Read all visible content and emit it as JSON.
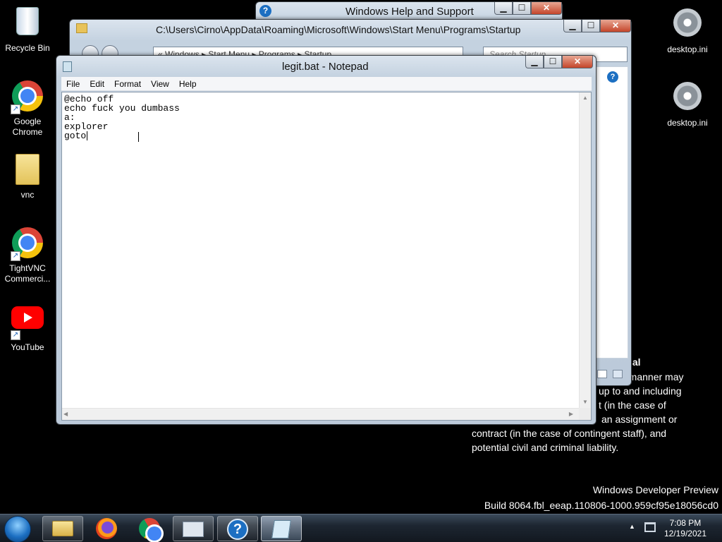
{
  "desktop": {
    "icons_left": [
      {
        "label": "Recycle Bin"
      },
      {
        "label": "Google Chrome"
      },
      {
        "label": "vnc"
      },
      {
        "label": "TightVNC Commerci..."
      },
      {
        "label": "YouTube"
      }
    ],
    "icons_right": [
      {
        "label": "desktop.ini"
      },
      {
        "label": "desktop.ini"
      }
    ],
    "background_text": {
      "line1_fragment": "ial",
      "line2_fragment": "ny manner may",
      "line3_fragment": "up to and including",
      "line4_fragment": "t (in the case of",
      "line5_fragment": "an assignment or",
      "line6": "contract (in the case of contingent staff), and",
      "line7": "potential civil and criminal liability."
    },
    "watermark": {
      "line1": "Windows Developer Preview",
      "line2": "Build 8064.fbl_eeap.110806-1000.959cf95e18056cd0"
    }
  },
  "help_window": {
    "title": "Windows Help and Support"
  },
  "explorer_window": {
    "title": "C:\\Users\\Cirno\\AppData\\Roaming\\Microsoft\\Windows\\Start Menu\\Programs\\Startup",
    "address": "«  Windows  ▸  Start Menu  ▸  Programs  ▸  Startup",
    "search_placeholder": "Search Startup"
  },
  "notepad": {
    "title": "legit.bat - Notepad",
    "menus": [
      "File",
      "Edit",
      "Format",
      "View",
      "Help"
    ],
    "content": "@echo off\necho fuck you dumbass\na:\nexplorer\ngoto"
  },
  "taskbar": {
    "time": "7:08 PM",
    "date": "12/19/2021"
  },
  "colors": {
    "desktop": "#000000",
    "close_button": "#c4452a",
    "taskbar": "#1d2631"
  }
}
